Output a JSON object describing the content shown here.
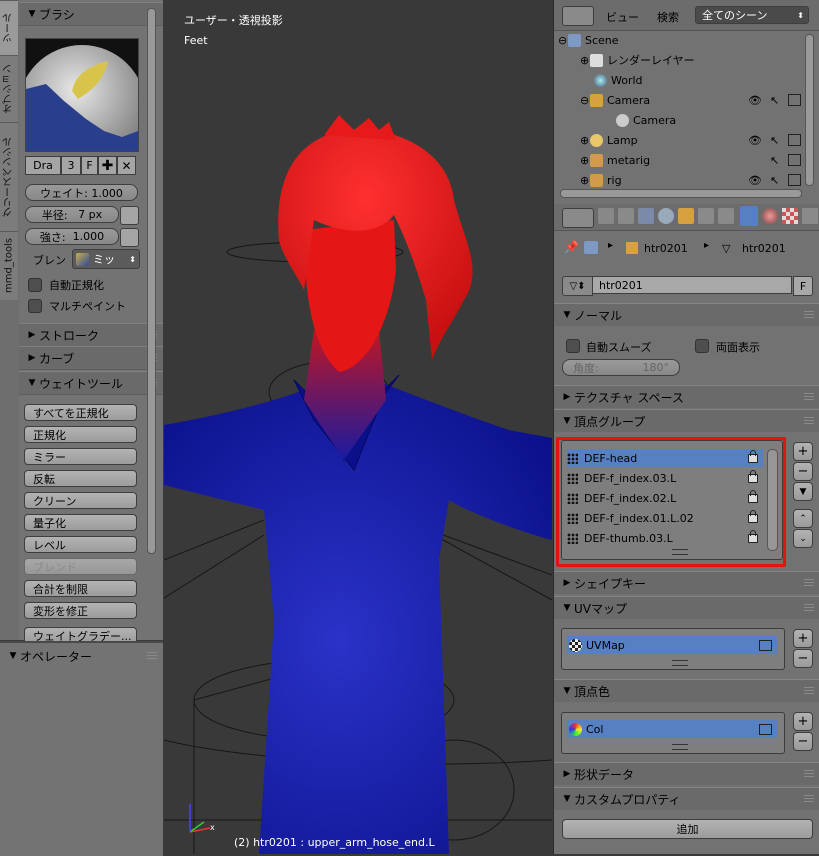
{
  "left_tabs": [
    "ツール",
    "オプション",
    "グリースペンシル",
    "mmd_tools"
  ],
  "brush_panel": {
    "title": "ブラシ",
    "brush_name": "Dra",
    "users": "3",
    "fake_user": "F",
    "weight_label": "ウェイト: 1.000",
    "radius_label": "半径:",
    "radius_value": "7 px",
    "strength_label": "強さ:",
    "strength_value": "1.000",
    "blend_label": "ブレン",
    "blend_value": "ミッ",
    "auto_normalize": "自動正規化",
    "multipaint": "マルチペイント"
  },
  "collapsed_panels": {
    "stroke": "ストローク",
    "curve": "カーブ"
  },
  "weight_tools": {
    "title": "ウェイトツール",
    "buttons": [
      "すべてを正規化",
      "正規化",
      "ミラー",
      "反転",
      "クリーン",
      "量子化",
      "レベル",
      "ブレンド",
      "合計を制限",
      "変形を修正",
      "ウェイトグラデー..."
    ]
  },
  "operator_panel": {
    "title": "オペレーター"
  },
  "viewport": {
    "view_name": "ユーザー・透視投影",
    "units": "Feet",
    "status": "(2) htr0201 : upper_arm_hose_end.L",
    "colors": {
      "hair": "#e01818",
      "body": "#101aa8",
      "background": "#393939"
    }
  },
  "outliner": {
    "view_label": "ビュー",
    "search_label": "検索",
    "scene_select": "全てのシーン",
    "rows": [
      "Scene",
      "レンダーレイヤー",
      "World",
      "Camera",
      "Camera",
      "Lamp",
      "metarig",
      "rig"
    ]
  },
  "properties": {
    "breadcrumb_obj": "htr0201",
    "breadcrumb_data": "htr0201",
    "mesh_name": "htr0201",
    "fake_user": "F",
    "normals": {
      "title": "ノーマル",
      "auto_smooth": "自動スムーズ",
      "double_sided": "両面表示",
      "angle_label": "角度:",
      "angle_value": "180°"
    },
    "texture_space": "テクスチャ スペース",
    "vertex_groups": {
      "title": "頂点グループ",
      "items": [
        "DEF-head",
        "DEF-f_index.03.L",
        "DEF-f_index.02.L",
        "DEF-f_index.01.L.02",
        "DEF-thumb.03.L"
      ]
    },
    "shape_keys": "シェイプキー",
    "uv_maps": {
      "title": "UVマップ",
      "items": [
        "UVMap"
      ]
    },
    "vertex_colors": {
      "title": "頂点色",
      "items": [
        "Col"
      ]
    },
    "geometry_data": "形状データ",
    "custom_props": {
      "title": "カスタムプロパティ",
      "add_label": "追加"
    },
    "highlight_color": "#e01414"
  }
}
